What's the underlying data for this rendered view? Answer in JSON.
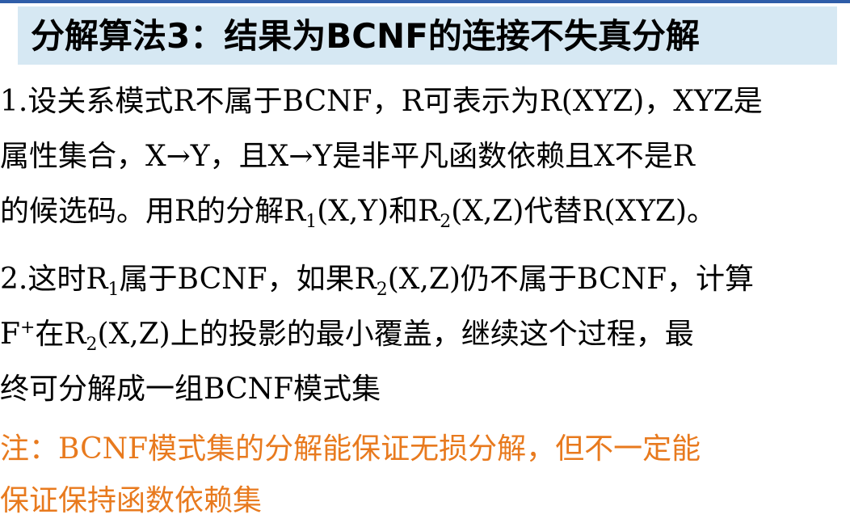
{
  "title": "分解算法3：结果为BCNF的连接不失真分解",
  "para1": {
    "line1": "1.设关系模式R不属于BCNF，R可表示为R(XYZ)，XYZ是",
    "line2": "属性集合，X→Y，且X→Y是非平凡函数依赖且X不是R",
    "line3_a": "的候选码。用R的分解R",
    "line3_sub1": "1",
    "line3_b": "(X,Y)和R",
    "line3_sub2": "2",
    "line3_c": "(X,Z)代替R(XYZ)。"
  },
  "para2": {
    "line1_a": "2.这时R",
    "line1_sub1": "1",
    "line1_b": "属于BCNF，如果R",
    "line1_sub2": "2",
    "line1_c": "(X,Z)仍不属于BCNF，计算",
    "line2_a": "F",
    "line2_sup": "+",
    "line2_b": "在R",
    "line2_sub": "2",
    "line2_c": "(X,Z)上的投影的最小覆盖，继续这个过程，最",
    "line3": "终可分解成一组BCNF模式集"
  },
  "note": {
    "line1": "注：BCNF模式集的分解能保证无损分解，但不一定能",
    "line2": "保证保持函数依赖集"
  },
  "colors": {
    "top_bar": "#2f5da8",
    "title_bg": "#d6e8f3",
    "note_text": "#e87a1e"
  }
}
